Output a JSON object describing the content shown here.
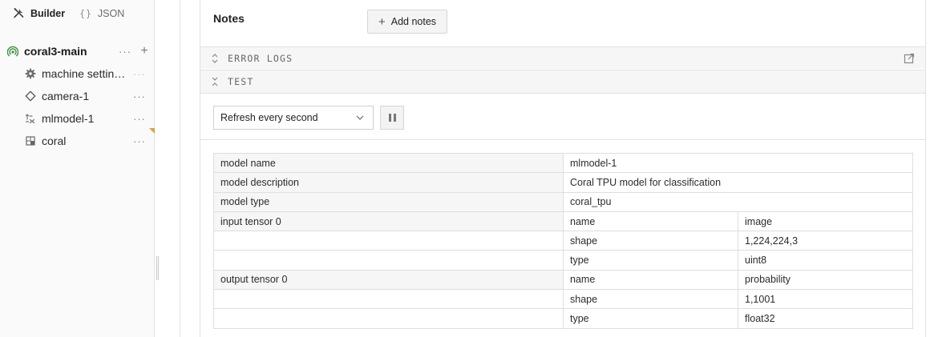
{
  "sidebar": {
    "tabs": [
      {
        "label": "Builder",
        "icon": "tools-icon"
      },
      {
        "label": "JSON",
        "icon": "braces-icon"
      }
    ],
    "root": {
      "label": "coral3-main",
      "icon": "online-status-icon",
      "status_color": "#3f8d3f"
    },
    "items": [
      {
        "label": "machine settin…",
        "icon": "gear-icon"
      },
      {
        "label": "camera-1",
        "icon": "camera-diamond-icon"
      },
      {
        "label": "mlmodel-1",
        "icon": "mlmodel-icon"
      },
      {
        "label": "coral",
        "icon": "module-icon"
      }
    ]
  },
  "main": {
    "notes": {
      "title": "Notes",
      "add_label": "Add notes"
    },
    "sections": [
      {
        "title": "ERROR LOGS",
        "state": "collapsed"
      },
      {
        "title": "TEST",
        "state": "expanded"
      }
    ],
    "test": {
      "refresh_select": "Refresh every second",
      "pause_icon": "pause-icon",
      "table": [
        {
          "key": "model name",
          "value": "mlmodel-1"
        },
        {
          "key": "model description",
          "value": "Coral TPU model for classification"
        },
        {
          "key": "model type",
          "value": "coral_tpu"
        },
        {
          "key": "input tensor 0",
          "fields": [
            {
              "name": "name",
              "value": "image"
            },
            {
              "name": "shape",
              "value": "1,224,224,3"
            },
            {
              "name": "type",
              "value": "uint8"
            }
          ]
        },
        {
          "key": "output tensor 0",
          "fields": [
            {
              "name": "name",
              "value": "probability"
            },
            {
              "name": "shape",
              "value": "1,1001"
            },
            {
              "name": "type",
              "value": "float32"
            }
          ]
        }
      ]
    }
  },
  "colors": {
    "warning_flag": "#e1a13b",
    "online": "#3f8d3f"
  }
}
